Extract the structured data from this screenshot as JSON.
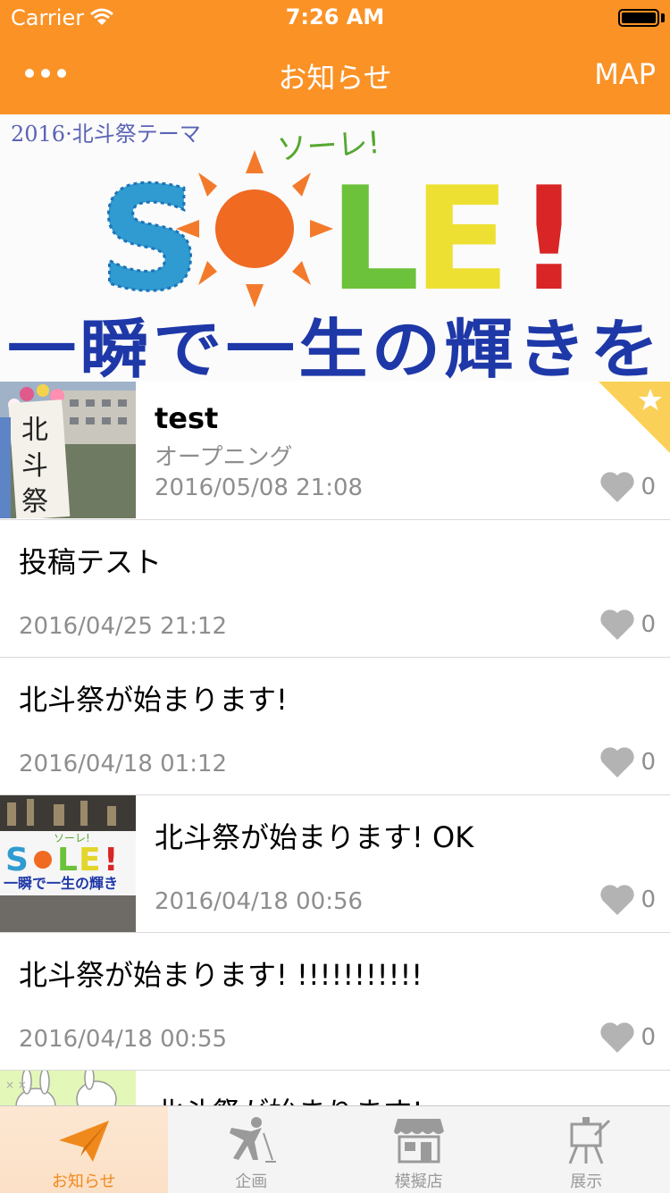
{
  "status_bar": {
    "carrier": "Carrier",
    "time": "7:26 AM"
  },
  "nav": {
    "title": "お知らせ",
    "right_button": "MAP",
    "left_icon": "more-dots-icon"
  },
  "banner": {
    "theme_label": "2016·北斗祭テーマ",
    "ruby": "ソーレ!",
    "word": [
      "S",
      "L",
      "E",
      "!"
    ],
    "slogan": "一瞬で一生の輝きを"
  },
  "posts": [
    {
      "title": "test",
      "category": "オープニング",
      "date": "2016/05/08 21:08",
      "likes": "0",
      "thumb": "photo-hokutosai-sign",
      "featured": true
    },
    {
      "title": "投稿テスト",
      "category": "",
      "date": "2016/04/25 21:12",
      "likes": "0"
    },
    {
      "title": "北斗祭が始まります!",
      "category": "",
      "date": "2016/04/18 01:12",
      "likes": "0"
    },
    {
      "title": "北斗祭が始まります!  OK",
      "category": "",
      "date": "2016/04/18 00:56",
      "likes": "0",
      "thumb": "photo-sole-banner"
    },
    {
      "title": "北斗祭が始まります!  !!!!!!!!!!!",
      "category": "",
      "date": "2016/04/18 00:55",
      "likes": "0"
    },
    {
      "title": "北斗祭が始まります!",
      "category": "",
      "date": "",
      "likes": "",
      "thumb": "illustration-rabbits"
    }
  ],
  "tabs": [
    {
      "label": "お知らせ",
      "icon": "paper-plane-icon",
      "active": true
    },
    {
      "label": "企画",
      "icon": "singer-icon",
      "active": false
    },
    {
      "label": "模擬店",
      "icon": "shop-icon",
      "active": false
    },
    {
      "label": "展示",
      "icon": "easel-icon",
      "active": false
    }
  ],
  "colors": {
    "accent": "#fa9226",
    "heart": "#b3b3b3",
    "ribbon": "#fbd058"
  }
}
